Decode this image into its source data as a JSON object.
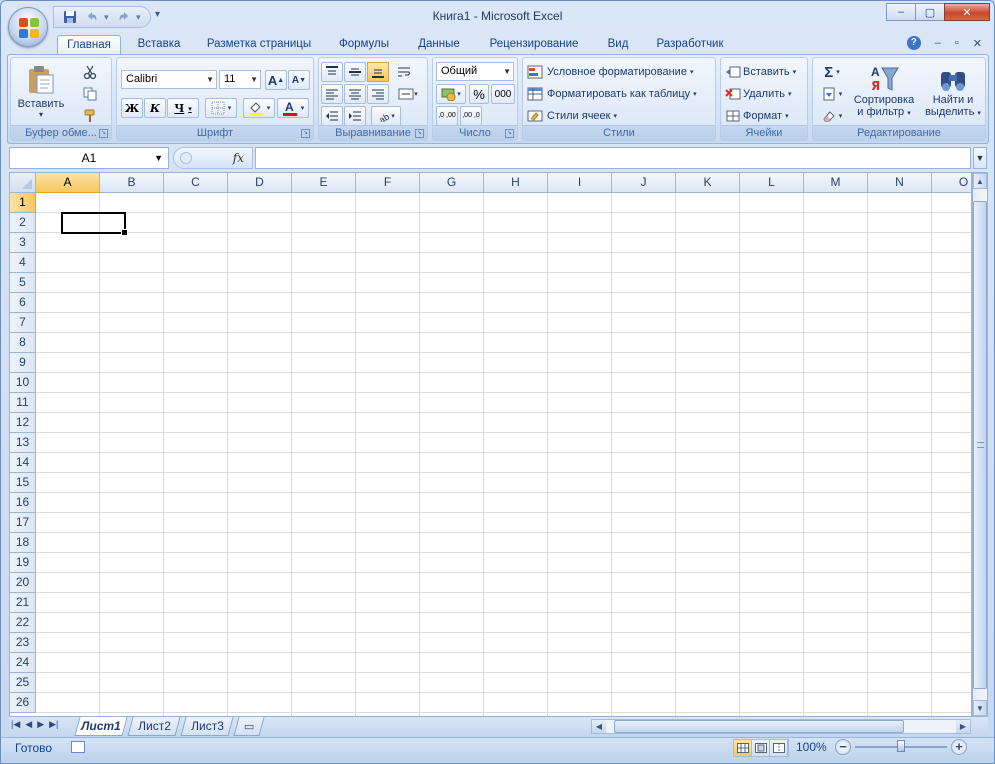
{
  "window": {
    "title": "Книга1 - Microsoft Excel",
    "controls": {
      "minimize": "–",
      "restore": "▢",
      "close": "✕"
    }
  },
  "qat": {
    "save_icon": "save-icon",
    "undo_icon": "undo-icon",
    "redo_icon": "redo-icon",
    "more": "▾"
  },
  "ribbon_tabs": [
    {
      "label": "Главная",
      "active": true
    },
    {
      "label": "Вставка"
    },
    {
      "label": "Разметка страницы"
    },
    {
      "label": "Формулы"
    },
    {
      "label": "Данные"
    },
    {
      "label": "Рецензирование"
    },
    {
      "label": "Вид"
    },
    {
      "label": "Разработчик"
    }
  ],
  "ribbon_ctrls": {
    "help": "?",
    "minimize": "–",
    "restore": "▫",
    "close": "✕"
  },
  "clipboard": {
    "label": "Буфер обме...",
    "paste": "Вставить"
  },
  "font": {
    "label": "Шрифт",
    "name": "Calibri",
    "size": "11",
    "bold": "Ж",
    "italic": "К",
    "underline": "Ч",
    "grow": "A",
    "shrink": "A",
    "fill_color": "#ffff00",
    "font_color": "#ff0000"
  },
  "alignment": {
    "label": "Выравнивание"
  },
  "number": {
    "label": "Число",
    "format": "Общий",
    "percent": "%",
    "thousands": "000",
    "inc_decimal": ",0 ,00",
    "dec_decimal": ",00 ,0"
  },
  "styles": {
    "label": "Стили",
    "conditional": "Условное форматирование",
    "as_table": "Форматировать как таблицу",
    "cell_styles": "Стили ячеек"
  },
  "cells": {
    "label": "Ячейки",
    "insert": "Вставить",
    "delete": "Удалить",
    "format": "Формат"
  },
  "editing": {
    "label": "Редактирование",
    "sum": "Σ",
    "sort_line1": "Сортировка",
    "sort_line2": "и фильтр",
    "find_line1": "Найти и",
    "find_line2": "выделить"
  },
  "formula_bar": {
    "name_box": "A1",
    "fx": "fx",
    "value": ""
  },
  "grid": {
    "columns": [
      "A",
      "B",
      "C",
      "D",
      "E",
      "F",
      "G",
      "H",
      "I",
      "J",
      "K",
      "L",
      "M",
      "N",
      "O"
    ],
    "rows": [
      "1",
      "2",
      "3",
      "4",
      "5",
      "6",
      "7",
      "8",
      "9",
      "10",
      "11",
      "12",
      "13",
      "14",
      "15",
      "16",
      "17",
      "18",
      "19",
      "20",
      "21",
      "22",
      "23",
      "24",
      "25",
      "26"
    ],
    "selected_col": "A",
    "selected_row": "1"
  },
  "sheets": [
    {
      "label": "Лист1",
      "active": true
    },
    {
      "label": "Лист2"
    },
    {
      "label": "Лист3"
    }
  ],
  "status": {
    "text": "Готово",
    "zoom": "100%"
  },
  "colors": {
    "accent": "#15428b",
    "selection": "#f6c75f",
    "gridline": "#dadcdd"
  }
}
